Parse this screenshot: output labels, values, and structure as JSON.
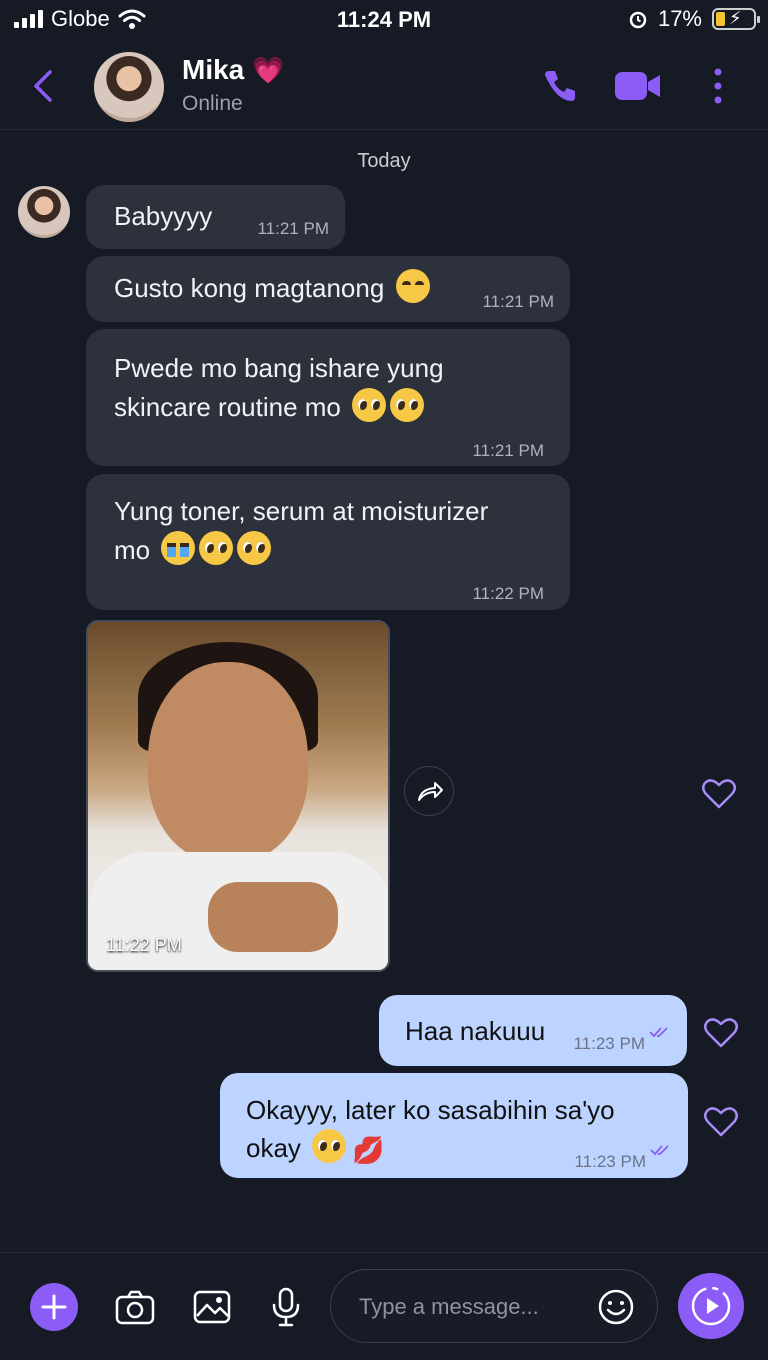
{
  "status_bar": {
    "carrier": "Globe",
    "time": "11:24 PM",
    "battery": "17%"
  },
  "header": {
    "name": "Mika",
    "status": "Online"
  },
  "date_separator": "Today",
  "incoming": [
    {
      "text": "Babyyyy",
      "time": "11:21 PM"
    },
    {
      "text": "Gusto kong magtanong",
      "time": "11:21 PM"
    },
    {
      "line1": "Pwede mo bang ishare yung",
      "line2": "skincare routine mo",
      "time": "11:21 PM"
    },
    {
      "line1": "Yung toner, serum at moisturizer",
      "line2": "mo",
      "time": "11:22 PM"
    }
  ],
  "photo": {
    "time": "11:22 PM"
  },
  "outgoing": [
    {
      "text": "Haa nakuuu",
      "time": "11:23 PM"
    },
    {
      "line1": "Okayyy, later ko sasabihin sa'yo",
      "line2": "okay",
      "time": "11:23 PM"
    }
  ],
  "composer": {
    "placeholder": "Type a message..."
  },
  "colors": {
    "accent": "#8b5cf6",
    "incoming_bubble": "#2d313c",
    "outgoing_bubble": "#bcd4ff",
    "background": "#161a24"
  }
}
